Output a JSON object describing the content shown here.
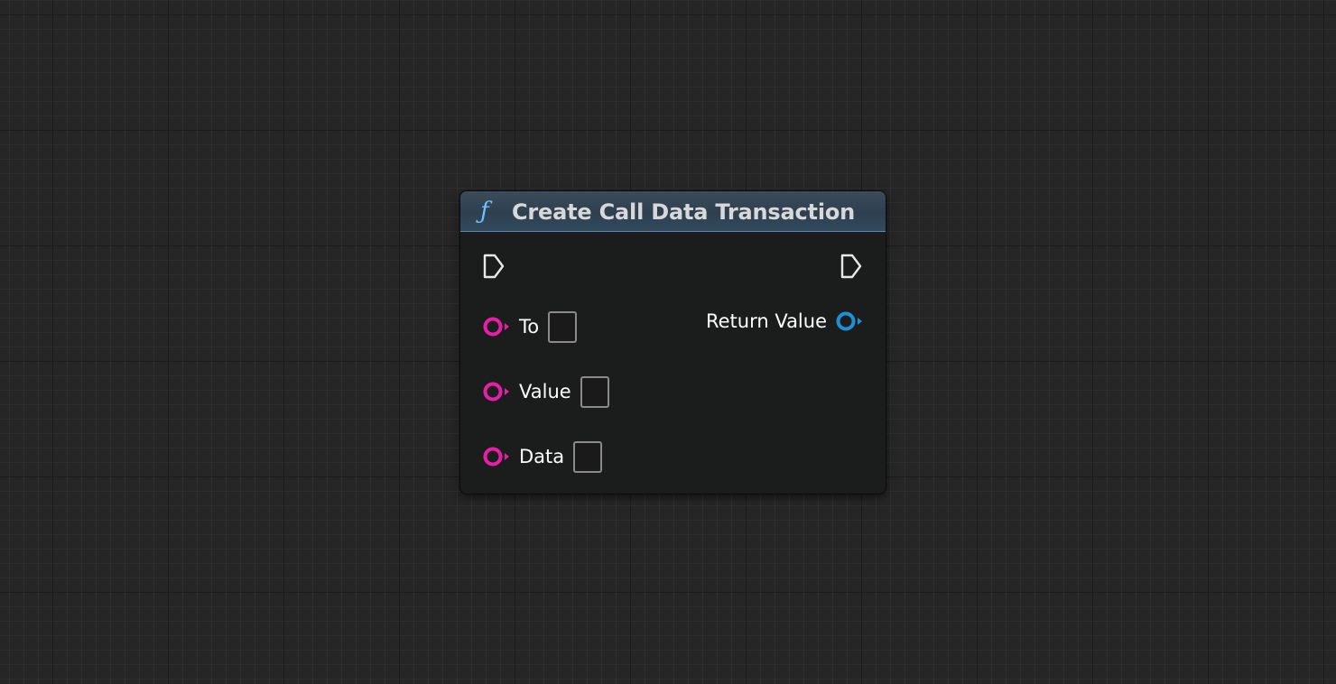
{
  "node": {
    "title": "Create Call Data Transaction",
    "icon": "function-icon",
    "icon_glyph": "ƒ",
    "header_color": "#2e4050",
    "inputs": [
      {
        "label": "To",
        "value": "",
        "pin_color": "#e61fa8"
      },
      {
        "label": "Value",
        "value": "",
        "pin_color": "#e61fa8"
      },
      {
        "label": "Data",
        "value": "",
        "pin_color": "#e61fa8"
      }
    ],
    "outputs": [
      {
        "label": "Return Value",
        "pin_color": "#1d8fd6"
      }
    ]
  }
}
